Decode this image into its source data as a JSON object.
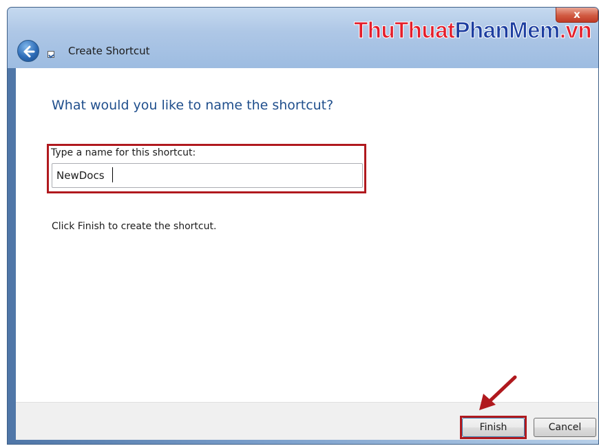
{
  "window": {
    "title": "Create Shortcut",
    "close_label": "x",
    "watermark": {
      "part1": "ThuThuat",
      "part2": "PhanMem",
      "part3": ".vn"
    }
  },
  "main": {
    "heading": "What would you like to name the shortcut?",
    "field_label": "Type a name for this shortcut:",
    "field_value": "NewDocs",
    "instruction": "Click Finish to create the shortcut."
  },
  "footer": {
    "finish_label": "Finish",
    "cancel_label": "Cancel"
  },
  "colors": {
    "heading": "#1f4e8c",
    "highlight": "#b0191e",
    "watermark_red": "#e41e2b",
    "watermark_blue": "#1d3ea0"
  },
  "icons": {
    "back": "back-arrow-icon",
    "shortcut": "shortcut-icon",
    "close": "close-icon",
    "pointer": "red-arrow-icon"
  }
}
